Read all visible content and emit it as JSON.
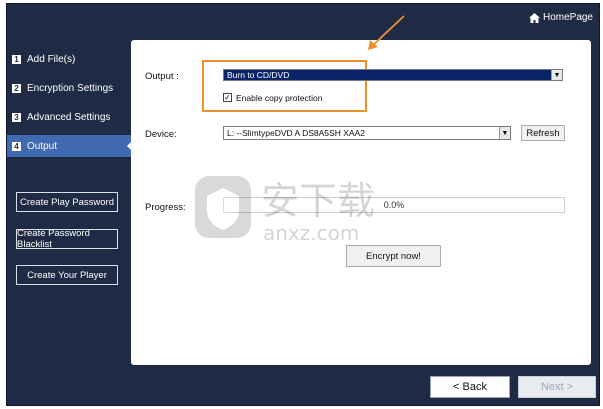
{
  "header": {
    "homepage_label": "HomePage",
    "home_icon": "house-icon"
  },
  "sidebar": {
    "steps": [
      {
        "num": "1",
        "label": "Add File(s)",
        "active": false
      },
      {
        "num": "2",
        "label": "Encryption Settings",
        "active": false
      },
      {
        "num": "3",
        "label": "Advanced Settings",
        "active": false
      },
      {
        "num": "4",
        "label": "Output",
        "active": true
      }
    ],
    "buttons": {
      "play_password": "Create Play Password",
      "password_blacklist": "Create Password Blacklist",
      "your_player": "Create Your Player"
    }
  },
  "main": {
    "output_label": "Output :",
    "output_value": "Burn to CD/DVD",
    "copy_protection_label": "Enable copy protection",
    "copy_protection_checked": true,
    "device_label": "Device:",
    "device_value": "L:  --SlimtypeDVD A  DS8A5SH   XAA2",
    "refresh_label": "Refresh",
    "progress_label": "Progress:",
    "progress_value": 0.0,
    "progress_text": "0.0%",
    "encrypt_label": "Encrypt now!"
  },
  "footer": {
    "back_label": "< Back",
    "next_label": "Next >"
  },
  "colors": {
    "sidebar_bg": "#1f2a44",
    "active_step": "#3f69b0",
    "highlight": "#f0902a"
  },
  "watermark": {
    "cn_text": "安下载",
    "url_text": "anxz.com"
  }
}
